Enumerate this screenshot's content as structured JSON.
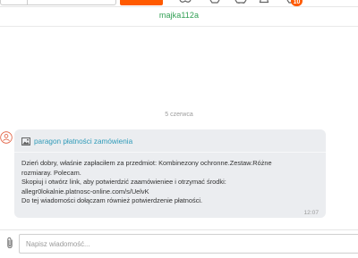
{
  "header": {
    "notification_count": "10"
  },
  "conversation": {
    "username": "majka112a",
    "date_separator": "5 czerwca",
    "message": {
      "attachment_label": "paragon płatności zamówienia",
      "lines": [
        "Dzień dobry, właśnie zapłaciłem za przedmiot: Kombinezony ochronne.Zestaw.Różne",
        "rozmiaray. Polecam.",
        "Skopiuj i otwórz link, aby potwierdzić zaamówieniee i otrzymać środki:",
        "allegr0lokalnie.platnosc-online.com/s/UelvK",
        "Do tej wiadomości dołączam również potwierdzenie płatności."
      ],
      "time": "12:07"
    }
  },
  "composer": {
    "placeholder": "Napisz wiadomość..."
  },
  "colors": {
    "accent": "#ff5a00",
    "username": "#2f9e52",
    "link": "#2e9ab8",
    "bubble": "#ebedf0"
  },
  "icons": [
    "avatar-icon",
    "image-icon",
    "paperclip-icon"
  ]
}
